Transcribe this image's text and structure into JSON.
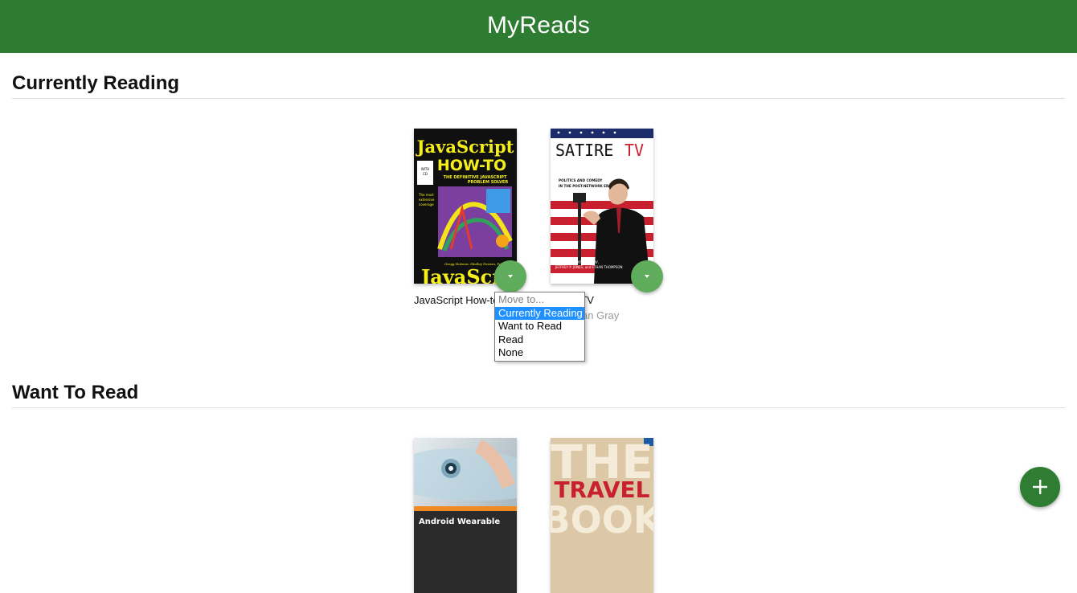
{
  "app": {
    "title": "MyReads"
  },
  "shelves": [
    {
      "title": "Currently Reading",
      "books": [
        {
          "title": "JavaScript How-to",
          "authors": "",
          "cover_text_top": "JavaScript",
          "cover_text_sub": "HOW-TO",
          "cover_tagline": "THE DEFINITIVE JAVASCRIPT PROBLEM SOLVER"
        },
        {
          "title": "Satire TV",
          "authors": "Jonathan Gray",
          "cover_text_top": "SATIRE",
          "cover_text_accent": "TV",
          "cover_tagline": "POLITICS AND COMEDY IN THE POST-NETWORK ERA"
        }
      ]
    },
    {
      "title": "Want To Read",
      "books": [
        {
          "title": "Android Wearable",
          "authors": "",
          "cover_text_bottom": "Android Wearable"
        },
        {
          "title": "The Travel Book",
          "authors": "",
          "cover_text_top": "THE",
          "cover_text_accent": "TRAVEL",
          "cover_text_bottom": "BOOK"
        }
      ]
    }
  ],
  "move_menu": {
    "header": "Move to...",
    "options": [
      "Currently Reading",
      "Want to Read",
      "Read",
      "None"
    ],
    "selected": "Currently Reading"
  },
  "colors": {
    "header_bg": "#2e7c31",
    "changer_bg": "#60ac5d",
    "add_button_bg": "#2e7d32",
    "selected_option": "#1e90ff"
  },
  "icons": {
    "shelf_changer": "caret-down-icon",
    "add_book": "plus-icon"
  }
}
